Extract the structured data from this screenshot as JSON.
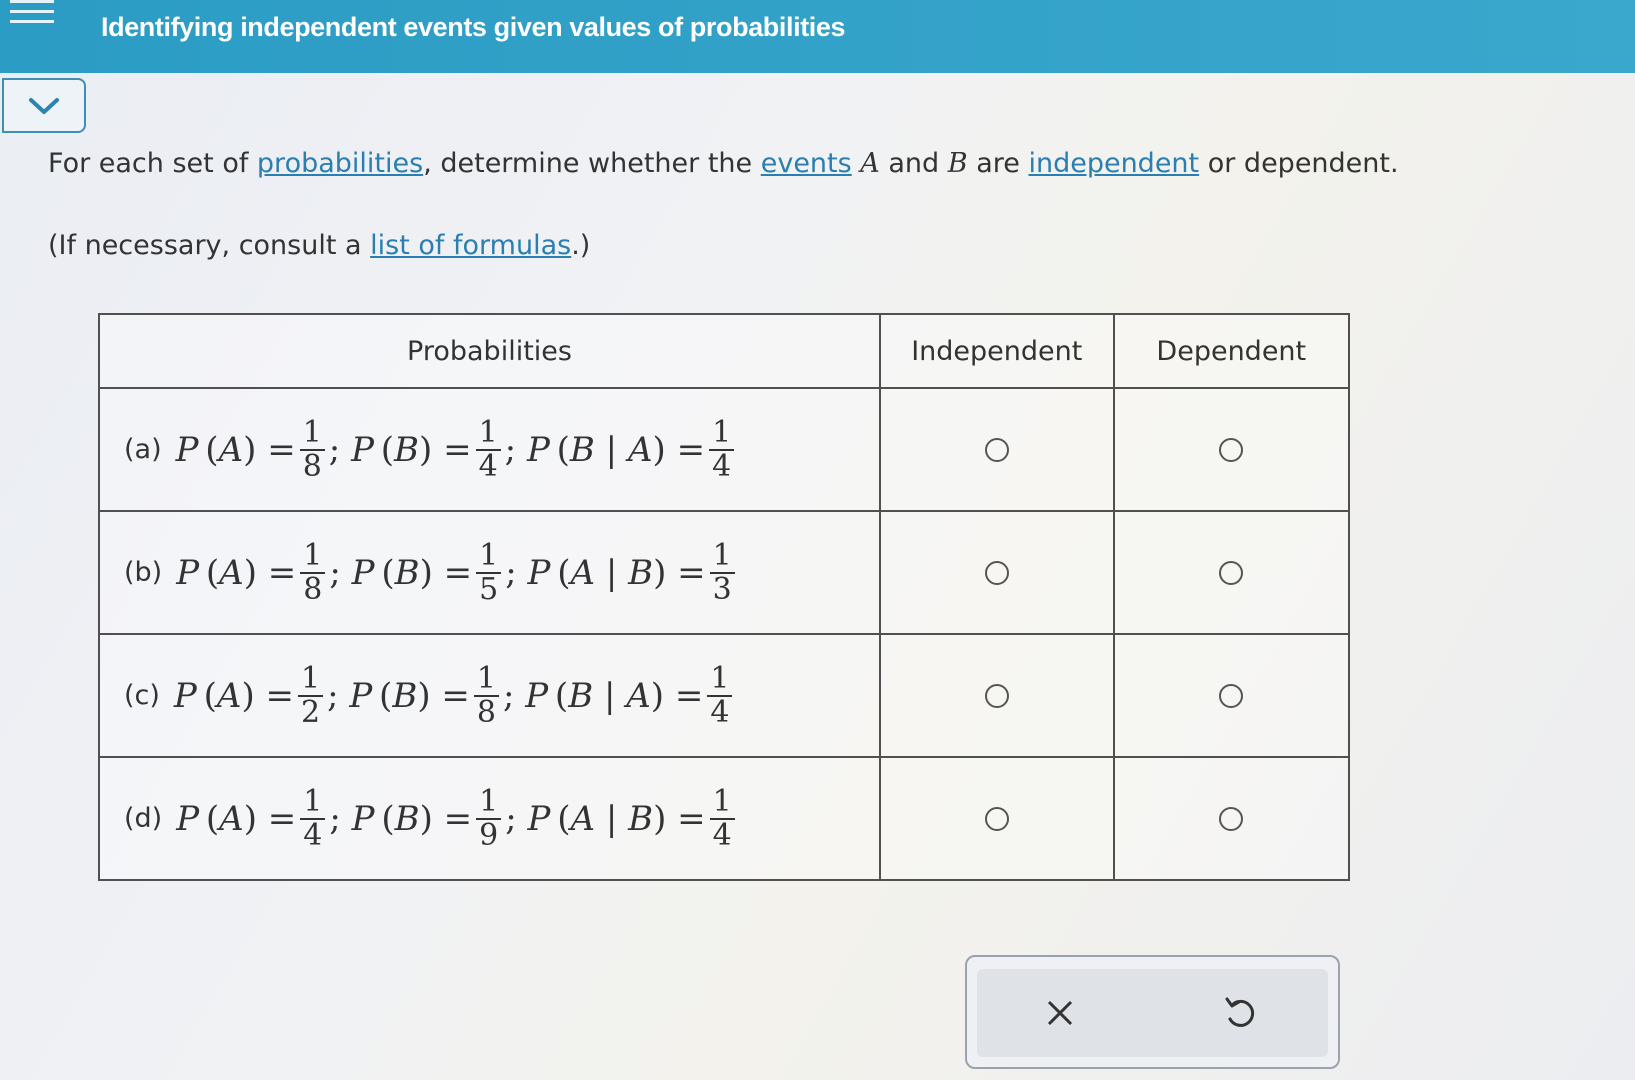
{
  "header": {
    "title": "Identifying independent events given values of probabilities"
  },
  "instructions": {
    "part1": "For each set of ",
    "link_probabilities": "probabilities",
    "part2": ", determine whether the ",
    "link_events": "events",
    "var_a": "A",
    "part3": " and ",
    "var_b": "B",
    "part4": " are ",
    "link_independent": "independent",
    "part5": " or dependent."
  },
  "hint": {
    "before": "(If necessary, consult a ",
    "link": "list of formulas",
    "after": ".)"
  },
  "table": {
    "headers": [
      "Probabilities",
      "Independent",
      "Dependent"
    ],
    "rows": [
      {
        "label": "(a)",
        "pa": {
          "num": "1",
          "den": "8"
        },
        "pb": {
          "num": "1",
          "den": "4"
        },
        "cond": "B | A",
        "pc": {
          "num": "1",
          "den": "4"
        }
      },
      {
        "label": "(b)",
        "pa": {
          "num": "1",
          "den": "8"
        },
        "pb": {
          "num": "1",
          "den": "5"
        },
        "cond": "A | B",
        "pc": {
          "num": "1",
          "den": "3"
        }
      },
      {
        "label": "(c)",
        "pa": {
          "num": "1",
          "den": "2"
        },
        "pb": {
          "num": "1",
          "den": "8"
        },
        "cond": "B | A",
        "pc": {
          "num": "1",
          "den": "4"
        }
      },
      {
        "label": "(d)",
        "pa": {
          "num": "1",
          "den": "4"
        },
        "pb": {
          "num": "1",
          "den": "9"
        },
        "cond": "A | B",
        "pc": {
          "num": "1",
          "den": "4"
        }
      }
    ]
  },
  "colors": {
    "header_bg": "#3aa7cd",
    "link": "#2a7fb0"
  },
  "actions": {
    "clear_icon": "x-icon",
    "undo_icon": "undo-icon"
  }
}
